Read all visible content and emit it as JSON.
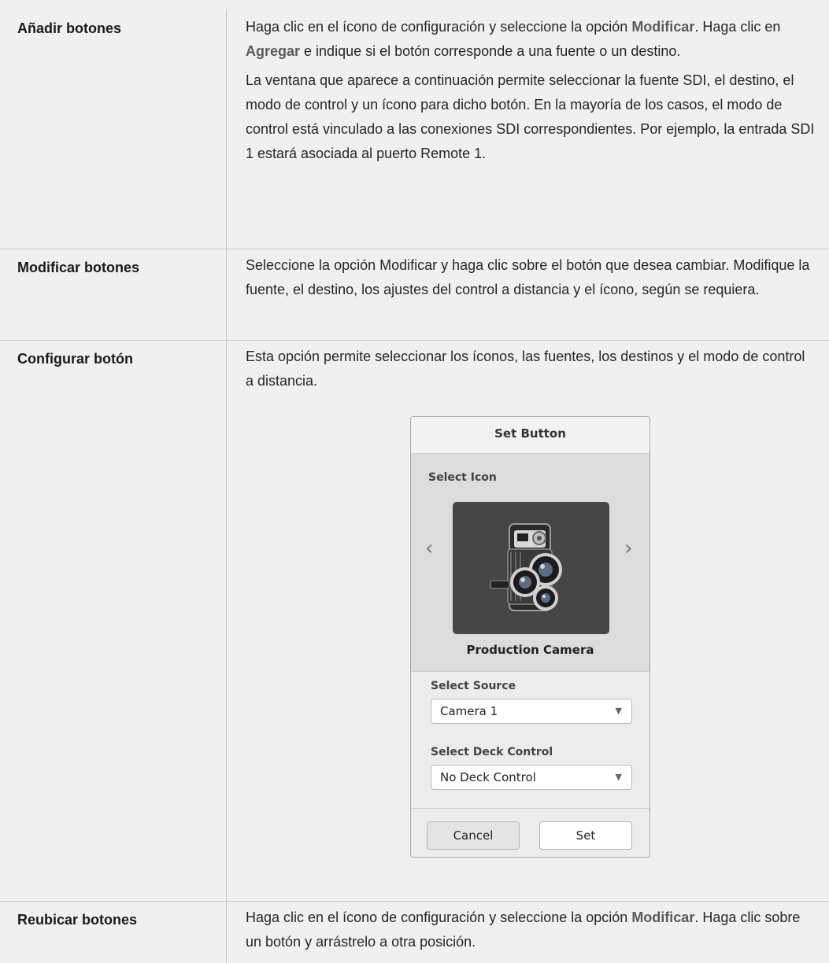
{
  "rows": [
    {
      "label": "Añadir botones",
      "paragraphs": [
        [
          "Haga clic en el ícono de configuración y seleccione la opción ",
          {
            "kw": "Modificar"
          },
          ". Haga clic en ",
          {
            "kw": "Agregar"
          },
          " e indique si el botón corresponde a una fuente o un destino."
        ],
        [
          "La ventana que aparece a continuación permite seleccionar la fuente SDI, el destino, el modo de control y un ícono para dicho botón. En la mayoría de los casos, el modo de control está vinculado a las conexiones SDI correspondientes. Por ejemplo, la entrada SDI 1 estará asociada al puerto Remote 1."
        ]
      ]
    },
    {
      "label": "Modificar botones",
      "paragraphs": [
        [
          "Seleccione la opción Modificar y haga clic sobre el botón que desea cambiar. Modifique la fuente, el destino, los ajustes del control a distancia y el ícono, según se requiera."
        ]
      ]
    },
    {
      "label": "Configurar botón",
      "paragraphs": [
        [
          "Esta opción permite seleccionar los íconos, las fuentes, los destinos y el modo de control a distancia."
        ]
      ]
    },
    {
      "label": "Reubicar botones",
      "paragraphs": [
        [
          "Haga clic en el ícono de configuración y seleccione la opción ",
          {
            "kw": "Modificar"
          },
          ". Haga clic sobre un botón y arrástrelo a otra posición."
        ]
      ]
    }
  ],
  "dialog": {
    "title": "Set Button",
    "select_icon_label": "Select Icon",
    "icon_name": "Production Camera",
    "icon": "movie-camera-icon",
    "prev_arrow": "‹",
    "next_arrow": "›",
    "source_label": "Select Source",
    "source_value": "Camera 1",
    "deck_label": "Select Deck Control",
    "deck_value": "No Deck Control",
    "cancel_label": "Cancel",
    "set_label": "Set"
  }
}
